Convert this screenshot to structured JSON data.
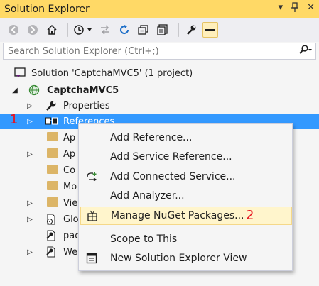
{
  "window": {
    "title": "Solution Explorer",
    "dropdown_glyph": "▾",
    "pin_glyph": "⊥",
    "close_glyph": "✕"
  },
  "toolbar": {
    "icons": [
      "back-icon",
      "forward-icon",
      "home-icon",
      "history-icon",
      "sync-icon",
      "refresh-icon",
      "collapse-all-icon",
      "show-all-files-icon",
      "properties-wrench-icon",
      "preview-icon"
    ]
  },
  "search": {
    "placeholder": "Search Solution Explorer (Ctrl+;)",
    "icon": "search-icon"
  },
  "tree": {
    "solution": "Solution 'CaptchaMVC5' (1 project)",
    "project": "CaptchaMVC5",
    "items": [
      {
        "label": "Properties",
        "icon": "wrench-icon"
      },
      {
        "label": "References",
        "icon": "references-icon"
      },
      {
        "label": "Ap",
        "icon": "folder-icon"
      },
      {
        "label": "Ap",
        "icon": "folder-icon"
      },
      {
        "label": "Co",
        "icon": "folder-icon"
      },
      {
        "label": "Mo",
        "icon": "folder-icon"
      },
      {
        "label": "Vie",
        "icon": "folder-icon"
      },
      {
        "label": "Glo",
        "icon": "global-asax-icon"
      },
      {
        "label": "pac",
        "icon": "config-file-icon"
      },
      {
        "label": "We",
        "icon": "config-file-icon"
      }
    ]
  },
  "annotations": {
    "marker1": "1",
    "marker2": "2"
  },
  "context_menu": {
    "items": [
      {
        "label": "Add Reference..."
      },
      {
        "label": "Add Service Reference..."
      },
      {
        "label": "Add Connected Service..."
      },
      {
        "label": "Add Analyzer..."
      },
      {
        "label": "Manage NuGet Packages..."
      },
      {
        "label": "Scope to This"
      },
      {
        "label": "New Solution Explorer View"
      }
    ]
  },
  "colors": {
    "title_bar": "#ffd966",
    "selection": "#3399ff",
    "marker": "#e8111d",
    "menu_highlight": "#fff5cc"
  }
}
